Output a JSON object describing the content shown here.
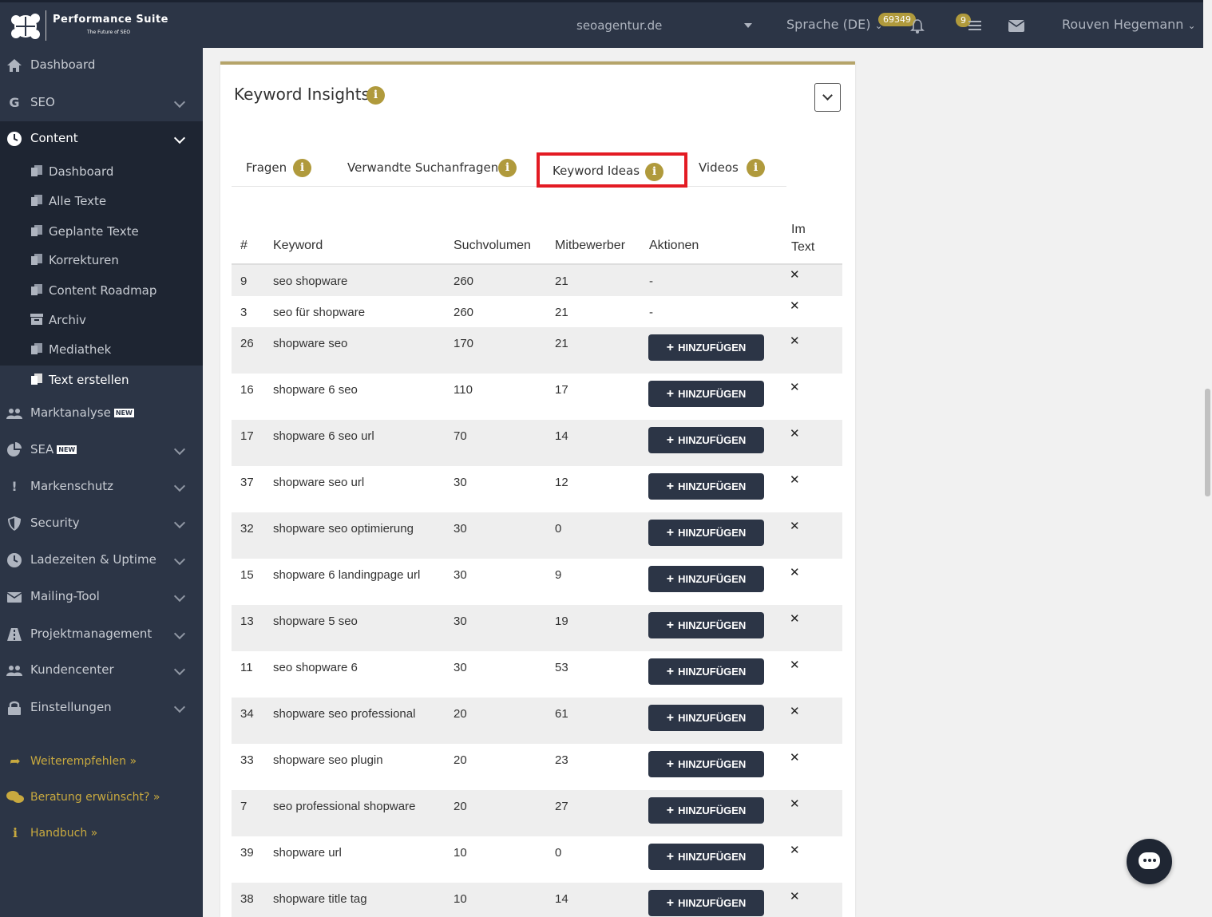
{
  "header": {
    "brand": "Performance Suite",
    "brand_sub": "The Future of SEO",
    "domain": "seoagentur.de",
    "language": "Sprache (DE)",
    "notif_count": "69349",
    "task_count": "9",
    "user": "Rouven Hegemann"
  },
  "sidebar": {
    "items": [
      {
        "label": "Dashboard",
        "icon": "home-icon"
      },
      {
        "label": "SEO",
        "icon": "google-icon"
      },
      {
        "label": "Content",
        "icon": "clock-icon"
      },
      {
        "label": "Marktanalyse",
        "icon": "users-icon",
        "tag": "NEW"
      },
      {
        "label": "SEA",
        "icon": "pie-chart-icon",
        "tag": "NEW"
      },
      {
        "label": "Markenschutz",
        "icon": "exclamation-icon"
      },
      {
        "label": "Security",
        "icon": "shield-icon"
      },
      {
        "label": "Ladezeiten & Uptime",
        "icon": "clock-icon"
      },
      {
        "label": "Mailing-Tool",
        "icon": "envelope-icon"
      },
      {
        "label": "Projektmanagement",
        "icon": "road-icon"
      },
      {
        "label": "Kundencenter",
        "icon": "users-icon"
      },
      {
        "label": "Einstellungen",
        "icon": "lock-icon"
      }
    ],
    "content_sub": [
      {
        "label": "Dashboard"
      },
      {
        "label": "Alle Texte"
      },
      {
        "label": "Geplante Texte"
      },
      {
        "label": "Korrekturen"
      },
      {
        "label": "Content Roadmap"
      },
      {
        "label": "Archiv"
      },
      {
        "label": "Mediathek"
      },
      {
        "label": "Text erstellen"
      }
    ],
    "links": [
      {
        "label": "Weiterempfehlen »",
        "icon": "share-icon"
      },
      {
        "label": "Beratung erwünscht? »",
        "icon": "comments-icon"
      },
      {
        "label": "Handbuch »",
        "icon": "info-icon"
      }
    ]
  },
  "card": {
    "title": "Keyword Insights",
    "tabs": [
      {
        "label": "Fragen"
      },
      {
        "label": "Verwandte Suchanfragen"
      },
      {
        "label": "Keyword Ideas"
      },
      {
        "label": "Videos"
      }
    ],
    "columns": {
      "num": "#",
      "keyword": "Keyword",
      "volume": "Suchvolumen",
      "competitors": "Mitbewerber",
      "actions": "Aktionen",
      "in_text_1": "Im",
      "in_text_2": "Text"
    },
    "add_label": "HINZUFÜGEN",
    "rows": [
      {
        "num": "9",
        "keyword": "seo shopware",
        "volume": "260",
        "competitors": "21",
        "action": "-"
      },
      {
        "num": "3",
        "keyword": "seo für shopware",
        "volume": "260",
        "competitors": "21",
        "action": "-"
      },
      {
        "num": "26",
        "keyword": "shopware seo",
        "volume": "170",
        "competitors": "21",
        "action": "add"
      },
      {
        "num": "16",
        "keyword": "shopware 6 seo",
        "volume": "110",
        "competitors": "17",
        "action": "add"
      },
      {
        "num": "17",
        "keyword": "shopware 6 seo url",
        "volume": "70",
        "competitors": "14",
        "action": "add"
      },
      {
        "num": "37",
        "keyword": "shopware seo url",
        "volume": "30",
        "competitors": "12",
        "action": "add"
      },
      {
        "num": "32",
        "keyword": "shopware seo optimierung",
        "volume": "30",
        "competitors": "0",
        "action": "add"
      },
      {
        "num": "15",
        "keyword": "shopware 6 landingpage url",
        "volume": "30",
        "competitors": "9",
        "action": "add"
      },
      {
        "num": "13",
        "keyword": "shopware 5 seo",
        "volume": "30",
        "competitors": "19",
        "action": "add"
      },
      {
        "num": "11",
        "keyword": "seo shopware 6",
        "volume": "30",
        "competitors": "53",
        "action": "add"
      },
      {
        "num": "34",
        "keyword": "shopware seo professional",
        "volume": "20",
        "competitors": "61",
        "action": "add"
      },
      {
        "num": "33",
        "keyword": "shopware seo plugin",
        "volume": "20",
        "competitors": "23",
        "action": "add"
      },
      {
        "num": "7",
        "keyword": "seo professional shopware",
        "volume": "20",
        "competitors": "27",
        "action": "add"
      },
      {
        "num": "39",
        "keyword": "shopware url",
        "volume": "10",
        "competitors": "0",
        "action": "add"
      },
      {
        "num": "38",
        "keyword": "shopware title tag",
        "volume": "10",
        "competitors": "14",
        "action": "add"
      }
    ]
  },
  "colors": {
    "sidebar_bg": "#2c3546",
    "accent_gold": "#b09a3c",
    "highlight_red": "#e31b23"
  }
}
